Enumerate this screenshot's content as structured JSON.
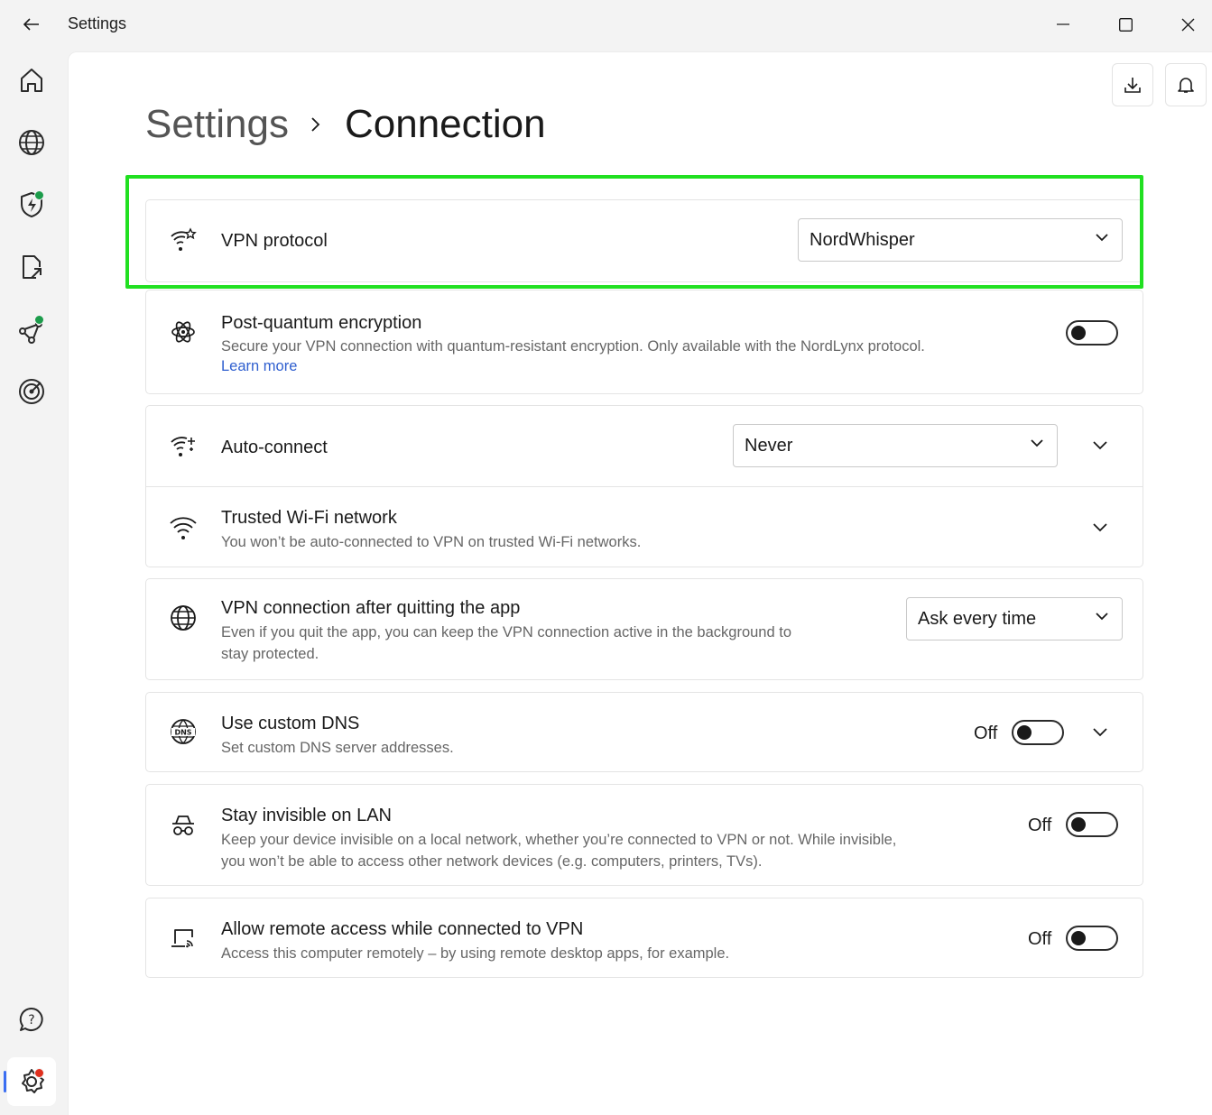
{
  "window": {
    "title": "Settings"
  },
  "rail": {
    "items": [
      "home-icon",
      "globe-icon",
      "shield-icon",
      "file-share-icon",
      "meshnet-icon",
      "target-icon",
      "help-icon",
      "settings-icon"
    ]
  },
  "breadcrumb": {
    "parent": "Settings",
    "current": "Connection"
  },
  "settings": {
    "vpn_protocol": {
      "title": "VPN protocol",
      "value": "NordWhisper"
    },
    "post_quantum": {
      "title": "Post-quantum encryption",
      "desc": "Secure your VPN connection with quantum-resistant encryption. Only available with the NordLynx protocol.",
      "link": "Learn more",
      "enabled": false
    },
    "auto_connect": {
      "title": "Auto-connect",
      "value": "Never"
    },
    "trusted_wifi": {
      "title": "Trusted Wi-Fi network",
      "desc": "You won’t be auto-connected to VPN on trusted Wi-Fi networks."
    },
    "after_quit": {
      "title": "VPN connection after quitting the app",
      "desc_line1": "Even if you quit the app, you can keep the VPN connection active in the background to",
      "desc_line2": "stay protected.",
      "value": "Ask every time"
    },
    "custom_dns": {
      "title": "Use custom DNS",
      "desc": "Set custom DNS server addresses.",
      "state": "Off",
      "enabled": false
    },
    "invisible_lan": {
      "title": "Stay invisible on LAN",
      "desc_line1": "Keep your device invisible on a local network, whether you’re connected to VPN or not. While invisible,",
      "desc_line2": "you won’t be able to access other network devices (e.g. computers, printers, TVs).",
      "state": "Off",
      "enabled": false
    },
    "remote_access": {
      "title": "Allow remote access while connected to VPN",
      "desc": "Access this computer remotely – by using remote desktop apps, for example.",
      "state": "Off",
      "enabled": false
    }
  },
  "colors": {
    "highlight": "#21e021",
    "link": "#2f5fcf",
    "status_green": "#1c9c4b",
    "status_red": "#e0301e"
  }
}
